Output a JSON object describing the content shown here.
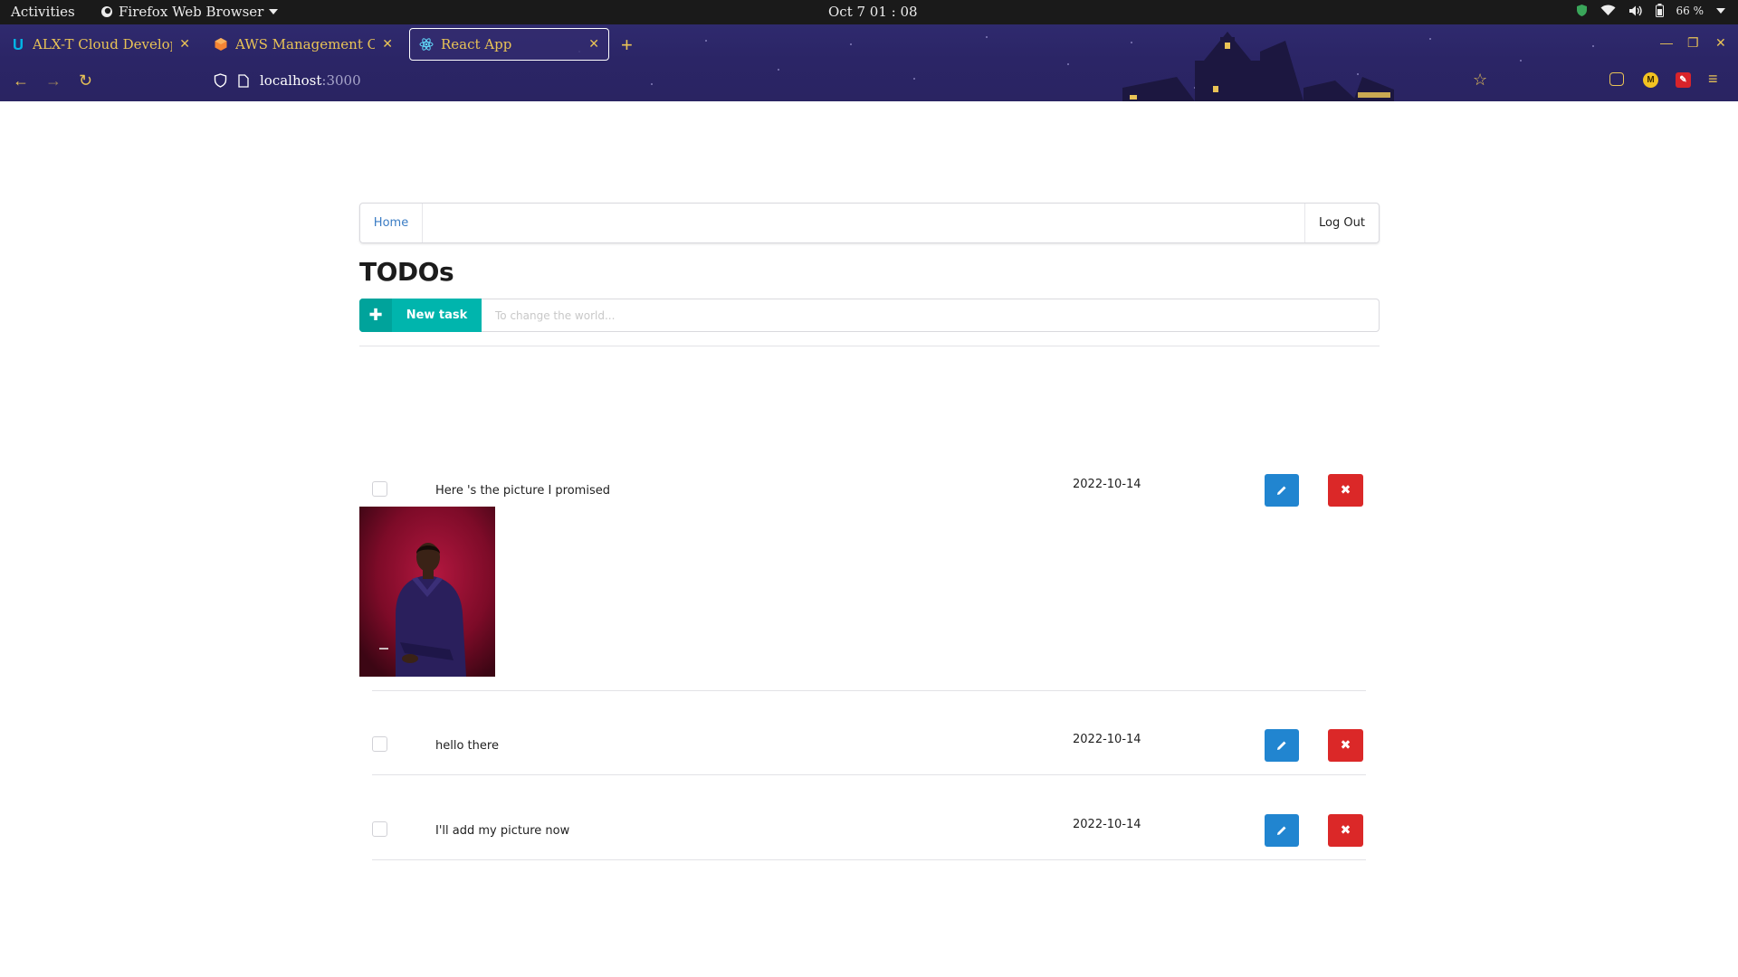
{
  "system_bar": {
    "activities": "Activities",
    "app_name": "Firefox Web Browser",
    "clock": "Oct 7  01 : 08",
    "battery": "66 %"
  },
  "browser": {
    "tabs": [
      {
        "title": "ALX-T Cloud Developer",
        "icon": "udacity-icon"
      },
      {
        "title": "AWS Management Con",
        "icon": "aws-icon"
      },
      {
        "title": "React App",
        "icon": "react-icon",
        "active": true
      }
    ],
    "url_host": "localhost",
    "url_port": ":3000",
    "accent_color": "#e9c356"
  },
  "app": {
    "menu": {
      "home": "Home",
      "logout": "Log Out"
    },
    "title": "TODOs",
    "new_task_label": "New task",
    "new_task_placeholder": "To change the world...",
    "todos": [
      {
        "name": "Here 's the picture I promised",
        "due_date": "2022-10-14",
        "done": false,
        "has_image": true
      },
      {
        "name": "hello there",
        "due_date": "2022-10-14",
        "done": false,
        "has_image": false
      },
      {
        "name": "I'll add my picture now",
        "due_date": "2022-10-14",
        "done": false,
        "has_image": false
      }
    ],
    "colors": {
      "primary": "#2185d0",
      "danger": "#db2828",
      "teal": "#00b5ad",
      "link": "#3a7cc4"
    }
  }
}
